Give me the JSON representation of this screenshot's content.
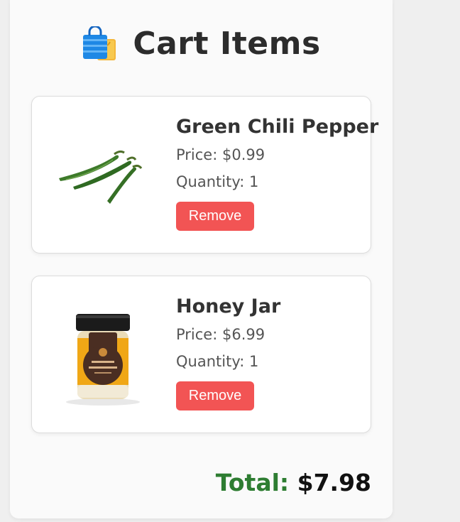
{
  "cart": {
    "title": "Cart Items",
    "items": [
      {
        "name": "Green Chili Pepper",
        "price": "Price: $0.99",
        "quantity": "Quantity: 1",
        "remove_label": "Remove",
        "image": "green-chili-pepper-image"
      },
      {
        "name": "Honey Jar",
        "price": "Price: $6.99",
        "quantity": "Quantity: 1",
        "remove_label": "Remove",
        "image": "honey-jar-image"
      }
    ],
    "total_label": "Total:",
    "total_value": "$7.98"
  },
  "colors": {
    "remove_button": "#f25454",
    "total_label": "#2e7d32",
    "title_text": "#2c2c2c"
  },
  "icons": {
    "title_icon": "shopping-bags-icon"
  }
}
